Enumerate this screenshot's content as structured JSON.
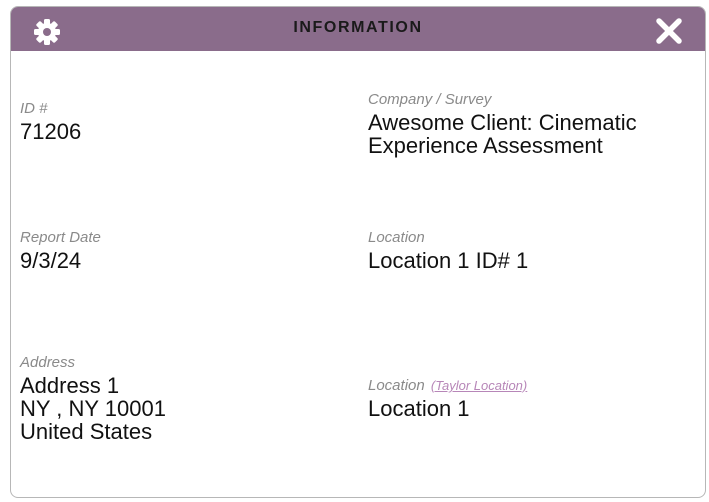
{
  "header": {
    "title": "INFORMATION",
    "settings_icon": "gear-icon",
    "close_icon": "close-icon",
    "bar_color": "#8a6c8b"
  },
  "fields": {
    "id": {
      "label": "ID #",
      "value": "71206"
    },
    "company_survey": {
      "label": "Company / Survey",
      "value_line1": "Awesome Client: Cinematic",
      "value_line2": "Experience Assessment"
    },
    "report_date": {
      "label": "Report Date",
      "value": "9/3/24"
    },
    "location_id": {
      "label": "Location",
      "value": "Location 1 ID# 1"
    },
    "address": {
      "label": "Address",
      "line1": "Address 1",
      "line2": "NY , NY 10001",
      "line3": "United States"
    },
    "location_name": {
      "label": "Location",
      "link": "(Taylor Location)",
      "value": "Location 1"
    }
  }
}
